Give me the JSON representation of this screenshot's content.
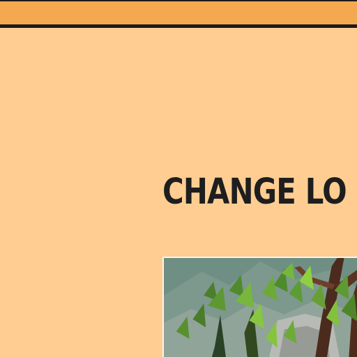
{
  "header": {
    "bar_color": "#f4a950"
  },
  "page": {
    "background_color": "#ffcd92",
    "title": "CHANGE LO"
  },
  "media": {
    "image_icon": "forest-thumbnail-icon"
  }
}
